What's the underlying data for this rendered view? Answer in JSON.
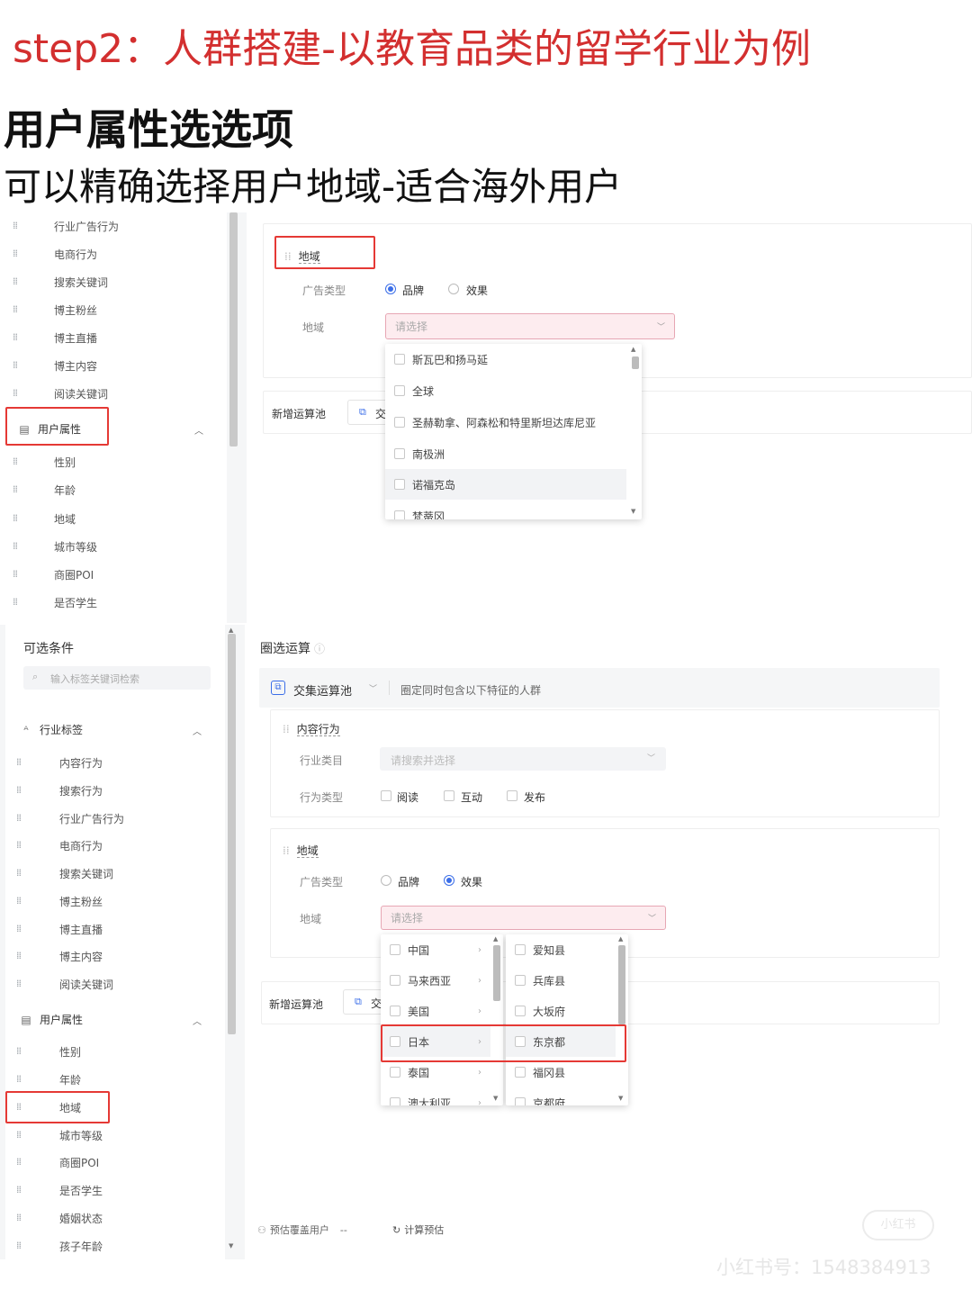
{
  "title": "step2：人群搭建-以教育品类的留学行业为例",
  "heading": "用户属性选选项",
  "subheading": "可以精确选择用户地域-适合海外用户",
  "top_shot": {
    "sidebar_items": [
      "行业广告行为",
      "电商行为",
      "搜索关键词",
      "博主粉丝",
      "博主直播",
      "博主内容",
      "阅读关键词"
    ],
    "section_user_attr": "用户属性",
    "attr_items": [
      "性别",
      "年龄",
      "地域",
      "城市等级",
      "商圈POI",
      "是否学生"
    ],
    "region_tag": "地域",
    "ad_type_label": "广告类型",
    "ad_type_options": [
      "品牌",
      "效果"
    ],
    "ad_type_selected": "品牌",
    "region_label": "地域",
    "select_placeholder": "请选择",
    "dropdown_options": [
      "斯瓦巴和扬马延",
      "全球",
      "圣赫勒拿、阿森松和特里斯坦达库尼亚",
      "南极洲",
      "诺福克岛",
      "梵蒂冈"
    ],
    "new_pool_label": "新增运算池",
    "new_pool_btn_text": "交"
  },
  "bottom_shot": {
    "left_title": "可选条件",
    "search_placeholder": "输入标签关键词检索",
    "section_industry": "行业标签",
    "industry_items": [
      "内容行为",
      "搜索行为",
      "行业广告行为",
      "电商行为",
      "搜索关键词",
      "博主粉丝",
      "博主直播",
      "博主内容",
      "阅读关键词"
    ],
    "section_user_attr": "用户属性",
    "attr_items": [
      "性别",
      "年龄",
      "地域",
      "城市等级",
      "商圈POI",
      "是否学生",
      "婚姻状态",
      "孩子年龄"
    ],
    "right_title": "圈选运算",
    "pool_name": "交集运算池",
    "pool_desc": "圈定同时包含以下特征的人群",
    "content_tag": "内容行为",
    "industry_cat_label": "行业类目",
    "industry_cat_placeholder": "请搜索并选择",
    "behavior_label": "行为类型",
    "behavior_options": [
      "阅读",
      "互动",
      "发布"
    ],
    "region_tag": "地域",
    "ad_type_label": "广告类型",
    "ad_type_options": [
      "品牌",
      "效果"
    ],
    "ad_type_selected": "效果",
    "region_label": "地域",
    "select_placeholder": "请选择",
    "countries": [
      "中国",
      "马来西亚",
      "美国",
      "日本",
      "泰国",
      "澳大利亚"
    ],
    "prefectures": [
      "爱知县",
      "兵库县",
      "大坂府",
      "东京都",
      "福冈县",
      "京都府"
    ],
    "new_pool_label": "新增运算池",
    "new_pool_btn_text": "交",
    "estimate_label": "预估覆盖用户",
    "estimate_value": "--",
    "calc_label": "计算预估"
  },
  "watermark": "小红书号：1548384913",
  "watermark_logo": "小红书"
}
